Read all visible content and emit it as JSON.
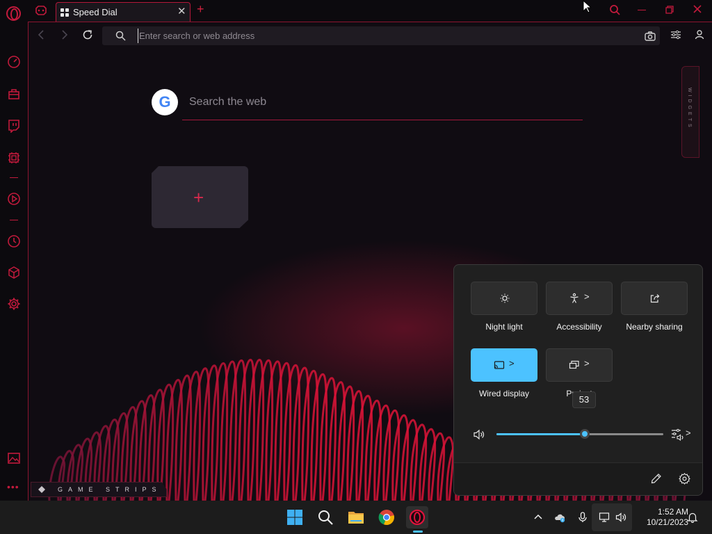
{
  "browser": {
    "tab_title": "Speed Dial",
    "address_placeholder": "Enter search or web address"
  },
  "speed_dial": {
    "search_placeholder": "Search the web",
    "search_engine_logo": "G",
    "add_tile_label": "+",
    "widgets_label": "WIDGETS",
    "game_strips_label": "GAME STRIPS"
  },
  "sidebar": {
    "items": [
      "speed-dial-icon",
      "shopping-bag-icon",
      "twitch-icon",
      "gx-control-icon",
      "player-icon",
      "history-icon",
      "extensions-icon",
      "settings-icon",
      "wallpaper-icon"
    ],
    "more": "•••"
  },
  "quick_settings": {
    "tiles": [
      {
        "label": "Night light",
        "icon": "brightness-icon",
        "active": false,
        "has_chevron": false
      },
      {
        "label": "Accessibility",
        "icon": "accessibility-icon",
        "active": false,
        "has_chevron": true
      },
      {
        "label": "Nearby sharing",
        "icon": "share-icon",
        "active": false,
        "has_chevron": false
      },
      {
        "label": "Wired display",
        "icon": "cast-icon",
        "active": true,
        "has_chevron": true
      },
      {
        "label": "Project",
        "icon": "project-icon",
        "active": false,
        "has_chevron": true
      }
    ],
    "chevron": ">",
    "volume": {
      "level": 53,
      "tooltip": "53"
    }
  },
  "taskbar": {
    "apps": [
      "windows-start-icon",
      "search-icon",
      "file-explorer-icon",
      "chrome-icon",
      "opera-gx-icon"
    ],
    "active_app": "opera-gx-icon",
    "tray": [
      "chevron-up-icon",
      "onedrive-icon",
      "microphone-icon",
      "network-icon",
      "speaker-icon",
      "notifications-icon"
    ],
    "time": "1:52 AM",
    "date": "10/21/2023"
  },
  "colors": {
    "accent_red": "#c21a3c",
    "windows_accent": "#4cc2ff",
    "panel_bg": "#202020"
  }
}
